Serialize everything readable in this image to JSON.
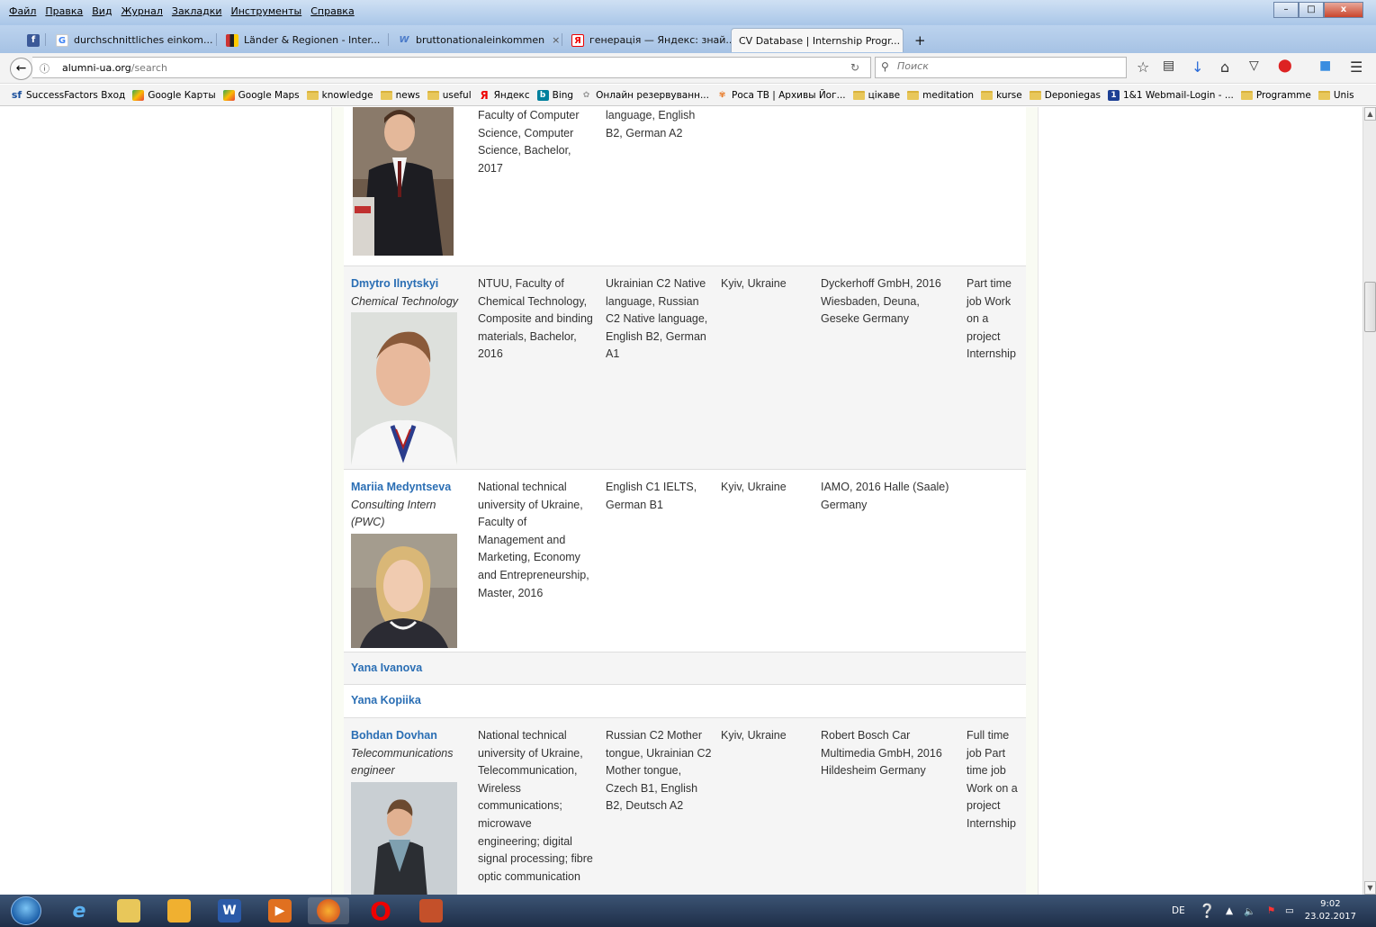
{
  "menu": [
    "Файл",
    "Правка",
    "Вид",
    "Журнал",
    "Закладки",
    "Инструменты",
    "Справка"
  ],
  "window_buttons": [
    "–",
    "□",
    "x"
  ],
  "tabs": [
    {
      "icon": "facebook-icon",
      "title": ""
    },
    {
      "icon": "google-icon",
      "title": "durchschnittliches einkom..."
    },
    {
      "icon": "chart-icon",
      "title": "Länder & Regionen - Inter..."
    },
    {
      "icon": "wikipedia-icon",
      "title": "bruttonationaleinkommen"
    },
    {
      "icon": "yandex-icon",
      "title": "генерація — Яндекс: знай..."
    },
    {
      "icon": "page-icon",
      "title": "CV Database | Internship Progr...",
      "active": true
    }
  ],
  "tab_close": "×",
  "new_tab": "+",
  "url": {
    "domain": "alumni-ua.org",
    "path": "/search"
  },
  "search_placeholder": "Поиск",
  "bookmarks": [
    {
      "icon": "sf",
      "label": "SuccessFactors Вход"
    },
    {
      "icon": "maps",
      "label": "Google Карты"
    },
    {
      "icon": "maps",
      "label": "Google Maps"
    },
    {
      "icon": "folder",
      "label": "knowledge"
    },
    {
      "icon": "folder",
      "label": "news"
    },
    {
      "icon": "folder",
      "label": "useful"
    },
    {
      "icon": "yandex",
      "label": "Яндекс"
    },
    {
      "icon": "bing",
      "label": "Bing"
    },
    {
      "icon": "globe",
      "label": "Онлайн резервуванн..."
    },
    {
      "icon": "flower",
      "label": "Роса ТВ | Архивы Йог..."
    },
    {
      "icon": "folder",
      "label": "цікаве"
    },
    {
      "icon": "folder",
      "label": "meditation"
    },
    {
      "icon": "folder",
      "label": "kurse"
    },
    {
      "icon": "folder",
      "label": "Deponiegas"
    },
    {
      "icon": "mail",
      "label": "1&1 Webmail-Login - ..."
    },
    {
      "icon": "folder",
      "label": "Programme"
    },
    {
      "icon": "folder",
      "label": "Unis"
    }
  ],
  "rows": [
    {
      "name": "",
      "role": "",
      "education": "Faculty of Computer Science, Computer Science, Bachelor, 2017",
      "languages": "language, English B2, German A2",
      "location": "",
      "internship": "",
      "type": ""
    },
    {
      "name": "Dmytro Ilnytskyi",
      "role": "Chemical Technology",
      "education": "NTUU, Faculty of Chemical Technology, Composite and binding materials, Bachelor, 2016",
      "languages": "Ukrainian C2 Native language, Russian C2 Native language, English B2, German A1",
      "location": "Kyiv, Ukraine",
      "internship": "Dyckerhoff GmbH, 2016 Wiesbaden, Deuna, Geseke Germany",
      "type": "Part time job Work on a project Internship"
    },
    {
      "name": "Mariia Medyntseva",
      "role": "Consulting Intern (PWC)",
      "education": "National technical university of Ukraine, Faculty of Management and Marketing, Economy and Entrepreneurship, Master, 2016",
      "languages": "English C1 IELTS, German B1",
      "location": "Kyiv, Ukraine",
      "internship": "IAMO, 2016 Halle (Saale) Germany",
      "type": ""
    },
    {
      "name": "Yana Ivanova"
    },
    {
      "name": "Yana Kopiika"
    },
    {
      "name": "Bohdan Dovhan",
      "role": "Telecommunications engineer",
      "education": "National technical university of Ukraine, Telecommunication, Wireless communications; microwave engineering; digital signal processing; fibre optic communication",
      "languages": "Russian C2 Mother tongue, Ukrainian C2 Mother tongue, Czech B1, English B2, Deutsch A2",
      "location": "Kyiv, Ukraine",
      "internship": "Robert Bosch Car Multimedia GmbH, 2016 Hildesheim Germany",
      "type": "Full time job Part time job Work on a project Internship"
    }
  ],
  "taskbar": {
    "apps": [
      "ie-icon",
      "explorer-icon",
      "paint-icon",
      "word-icon",
      "media-player-icon",
      "firefox-icon",
      "opera-icon",
      "app-icon"
    ],
    "lang": "DE",
    "time": "9:02",
    "date": "23.02.2017"
  },
  "colors": {
    "name_link": "#2a6eb4",
    "panel_bg": "#f9fbf3",
    "row_alt": "#f5f5f5"
  }
}
